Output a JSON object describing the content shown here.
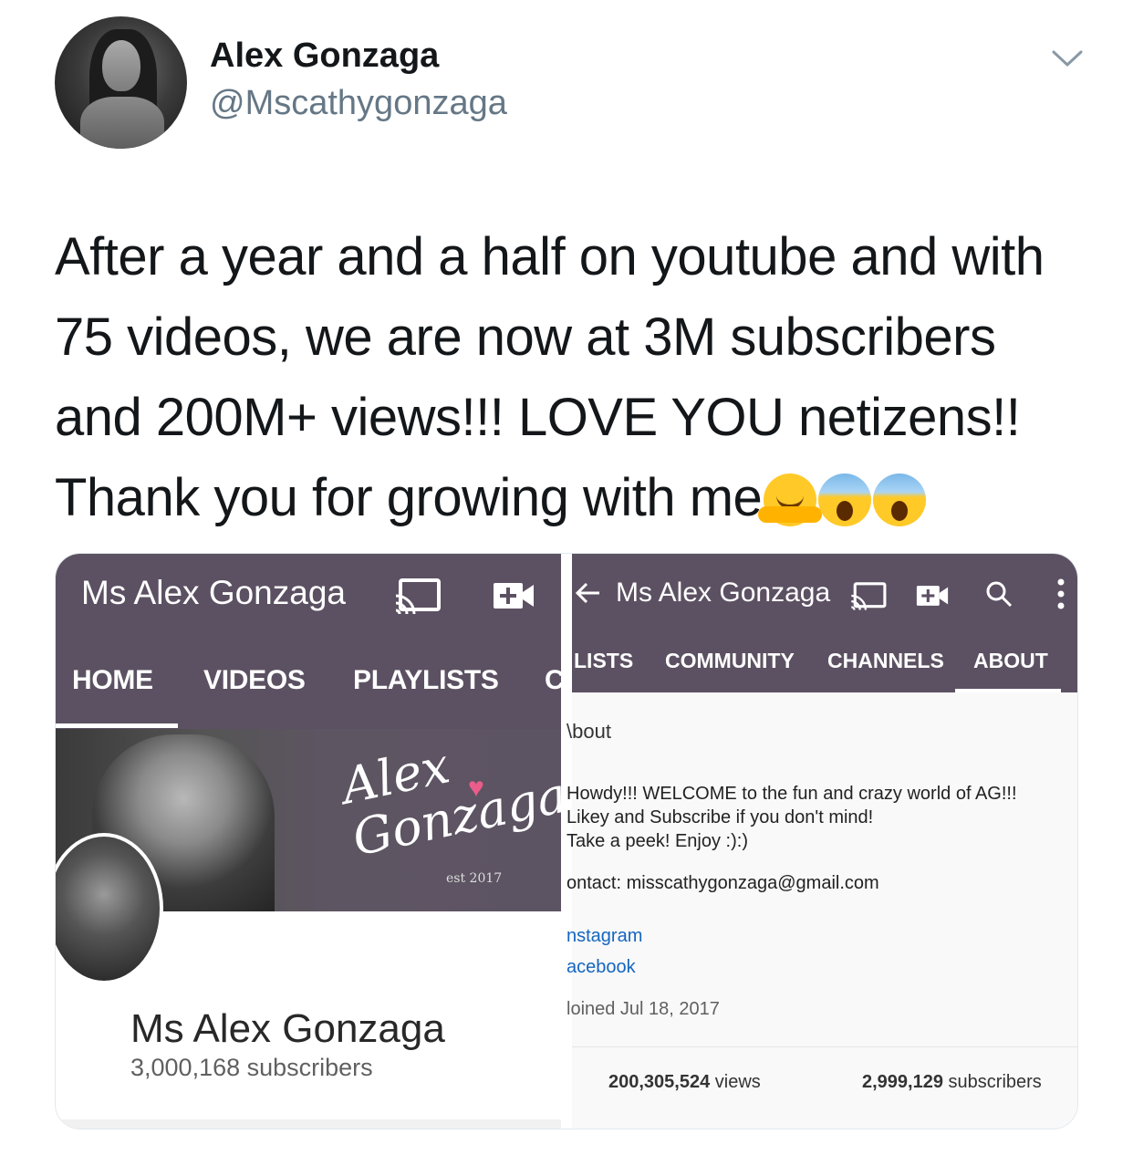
{
  "tweet": {
    "author_name": "Alex Gonzaga",
    "author_handle": "@Mscathygonzaga",
    "text": "After a year and a half on youtube and with 75 videos, we are now at 3M subscribers and 200M+ views!!! LOVE YOU netizens!! Thank you for growing with me",
    "emojis": [
      "hugging-face-emoji",
      "screaming-face-emoji",
      "screaming-face-emoji"
    ]
  },
  "left_screenshot": {
    "channel_title": "Ms Alex Gonzaga",
    "tabs": [
      "HOME",
      "VIDEOS",
      "PLAYLISTS",
      "C"
    ],
    "banner_logo_line1": "Alex",
    "banner_logo_line2": "Gonzaga",
    "banner_est": "est 2017",
    "channel_name": "Ms Alex Gonzaga",
    "subscribers": "3,000,168 subscribers"
  },
  "right_screenshot": {
    "channel_title": "Ms Alex Gonzaga",
    "tabs": [
      "LISTS",
      "COMMUNITY",
      "CHANNELS",
      "ABOUT"
    ],
    "about_heading": "\\bout",
    "description_lines": [
      "Howdy!!! WELCOME to the fun and crazy world of AG!!!",
      "Likey and Subscribe if you don't mind!",
      "Take a peek! Enjoy :):)"
    ],
    "contact": "ontact: misscathygonzaga@gmail.com",
    "links": [
      "nstagram",
      "acebook"
    ],
    "joined": "loined Jul 18, 2017",
    "views_number": "200,305,524",
    "views_label": "views",
    "subs_number": "2,999,129",
    "subs_label": "subscribers"
  },
  "colors": {
    "appbar": "#5c5162",
    "handle_gray": "#657786",
    "link_blue": "#1565c0"
  }
}
